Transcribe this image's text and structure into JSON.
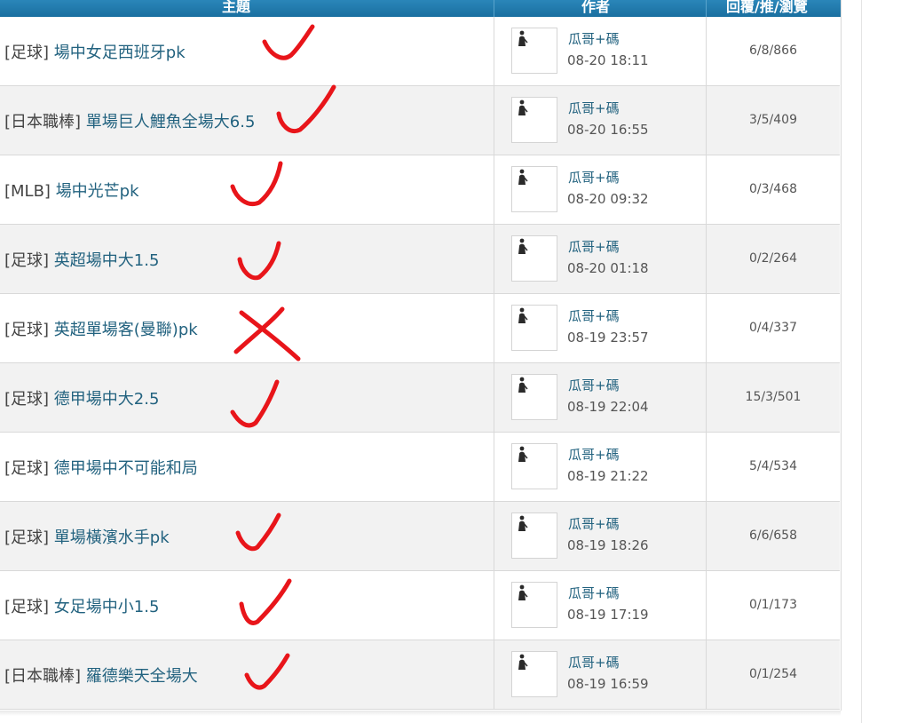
{
  "header": {
    "topic_label": "主題",
    "author_label": "作者",
    "stats_label": "回覆/推/瀏覽"
  },
  "rows": [
    {
      "tag": "[足球]",
      "title": "場中女足西班牙pk",
      "author": "瓜哥+碼",
      "time": "08-20 18:11",
      "stats": "6/8/866",
      "mark": "check"
    },
    {
      "tag": "[日本職棒]",
      "title": "單場巨人鯉魚全場大6.5",
      "author": "瓜哥+碼",
      "time": "08-20 16:55",
      "stats": "3/5/409",
      "mark": "check"
    },
    {
      "tag": "[MLB]",
      "title": "場中光芒pk",
      "author": "瓜哥+碼",
      "time": "08-20 09:32",
      "stats": "0/3/468",
      "mark": "check"
    },
    {
      "tag": "[足球]",
      "title": "英超場中大1.5",
      "author": "瓜哥+碼",
      "time": "08-20 01:18",
      "stats": "0/2/264",
      "mark": "check"
    },
    {
      "tag": "[足球]",
      "title": "英超單場客(曼聯)pk",
      "author": "瓜哥+碼",
      "time": "08-19 23:57",
      "stats": "0/4/337",
      "mark": "cross"
    },
    {
      "tag": "[足球]",
      "title": "德甲場中大2.5",
      "author": "瓜哥+碼",
      "time": "08-19 22:04",
      "stats": "15/3/501",
      "mark": "check"
    },
    {
      "tag": "[足球]",
      "title": "德甲場中不可能和局",
      "author": "瓜哥+碼",
      "time": "08-19 21:22",
      "stats": "5/4/534",
      "mark": "none"
    },
    {
      "tag": "[足球]",
      "title": "單場橫濱水手pk",
      "author": "瓜哥+碼",
      "time": "08-19 18:26",
      "stats": "6/6/658",
      "mark": "check"
    },
    {
      "tag": "[足球]",
      "title": "女足場中小1.5",
      "author": "瓜哥+碼",
      "time": "08-19 17:19",
      "stats": "0/1/173",
      "mark": "check"
    },
    {
      "tag": "[日本職棒]",
      "title": "羅德樂天全場大",
      "author": "瓜哥+碼",
      "time": "08-19 16:59",
      "stats": "0/1/254",
      "mark": "check"
    }
  ],
  "colors": {
    "header_bg": "#1a6fa0",
    "link": "#22627f",
    "mark_red": "#e8151a"
  },
  "icons": {
    "avatar": "person-silhouette-icon",
    "check": "red-check-mark-icon",
    "cross": "red-cross-mark-icon"
  }
}
